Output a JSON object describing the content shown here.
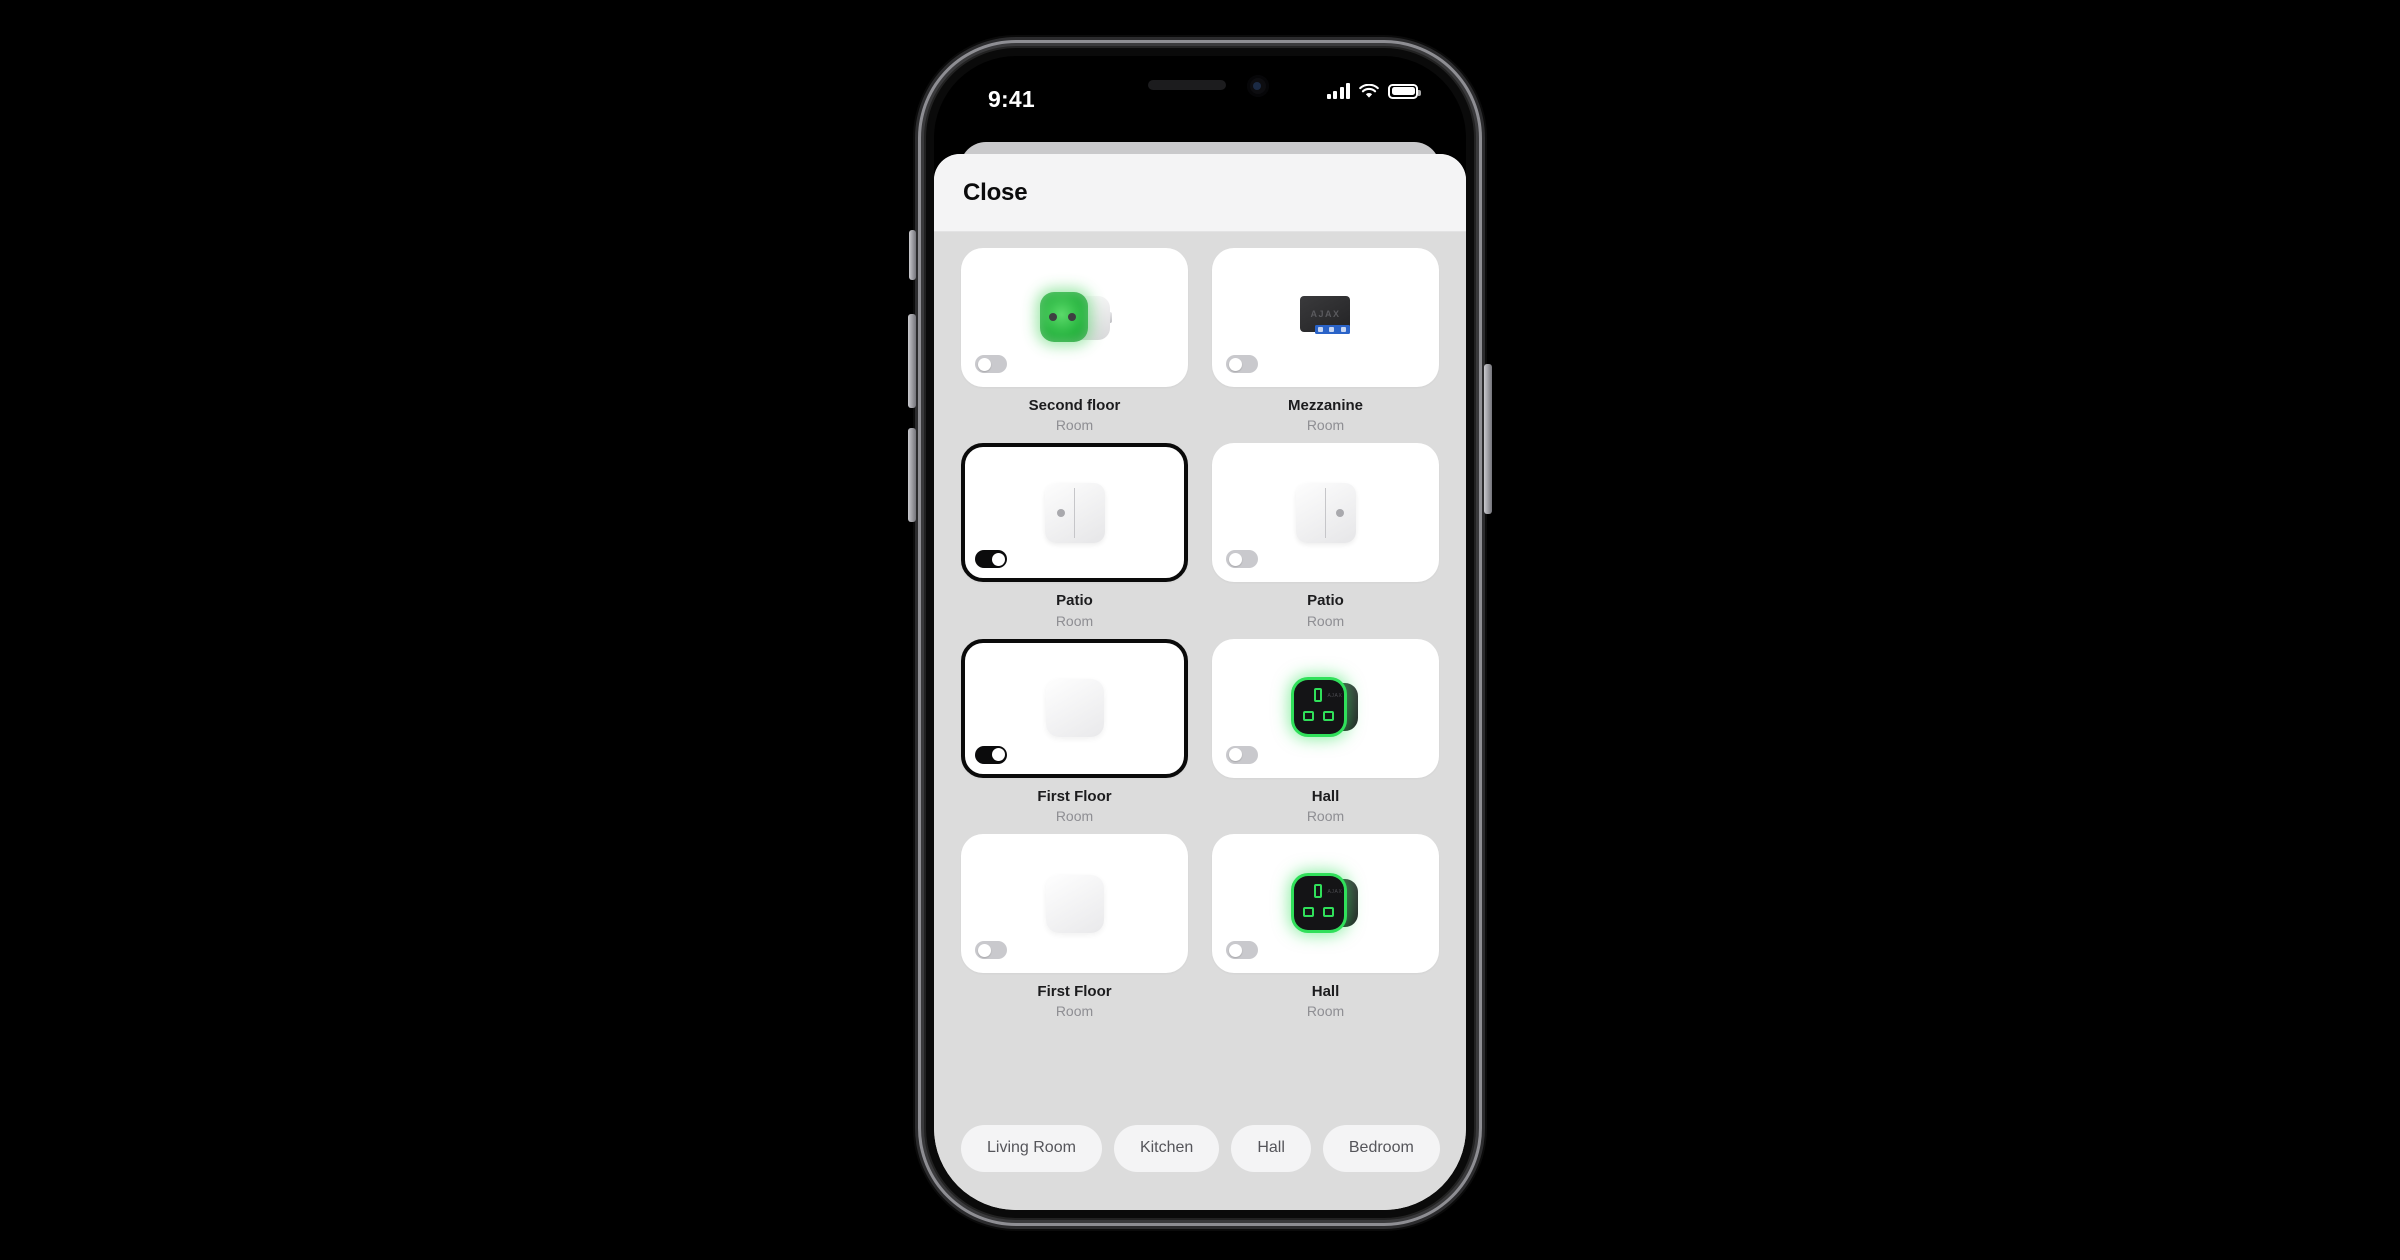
{
  "status_bar": {
    "time": "9:41",
    "cellular_icon": "signal-bars-icon",
    "wifi_icon": "wifi-icon",
    "battery_icon": "battery-full-icon"
  },
  "sheet": {
    "close_label": "Close"
  },
  "devices": [
    {
      "name": "Second floor",
      "subtitle": "Room",
      "artwork": "eu-smart-plug",
      "toggle_on": false,
      "selected": false
    },
    {
      "name": "Mezzanine",
      "subtitle": "Room",
      "artwork": "ajax-relay",
      "toggle_on": false,
      "selected": false
    },
    {
      "name": "Patio",
      "subtitle": "Room",
      "artwork": "wall-switch-left",
      "toggle_on": true,
      "selected": true
    },
    {
      "name": "Patio",
      "subtitle": "Room",
      "artwork": "wall-switch-right",
      "toggle_on": false,
      "selected": false
    },
    {
      "name": "First Floor",
      "subtitle": "Room",
      "artwork": "blank-square",
      "toggle_on": true,
      "selected": true
    },
    {
      "name": "Hall",
      "subtitle": "Room",
      "artwork": "uk-socket",
      "toggle_on": false,
      "selected": false
    },
    {
      "name": "First Floor",
      "subtitle": "Room",
      "artwork": "blank-square",
      "toggle_on": false,
      "selected": false
    },
    {
      "name": "Hall",
      "subtitle": "Room",
      "artwork": "uk-socket",
      "toggle_on": false,
      "selected": false
    }
  ],
  "room_filters": [
    {
      "label": "Living Room"
    },
    {
      "label": "Kitchen"
    },
    {
      "label": "Hall"
    },
    {
      "label": "Bedroom"
    }
  ],
  "colors": {
    "accent_green": "#30e05a",
    "selected_border": "#0a0a0a",
    "sheet_background": "#dcdcdc",
    "card_background": "#ffffff",
    "subtitle_text": "#8e8e93"
  }
}
